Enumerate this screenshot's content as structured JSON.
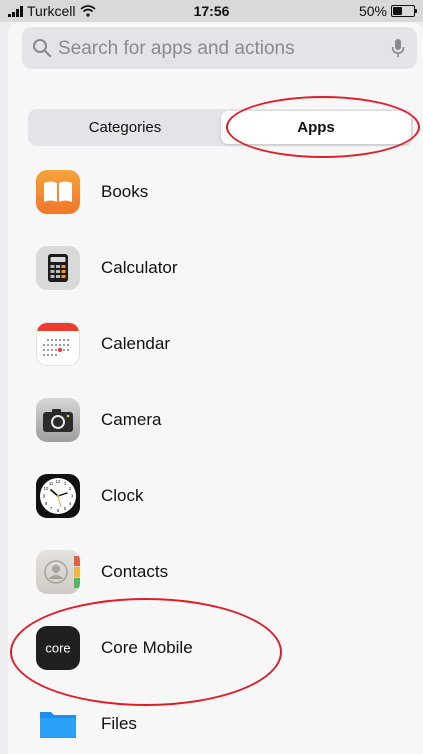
{
  "status_bar": {
    "carrier": "Turkcell",
    "time": "17:56",
    "battery_text": "50%",
    "battery_level": 0.5
  },
  "search": {
    "placeholder": "Search for apps and actions",
    "value": "",
    "icon": "magnifying-glass-icon",
    "mic_icon": "microphone-icon"
  },
  "segmented_control": {
    "options": [
      {
        "label": "Categories",
        "selected": false
      },
      {
        "label": "Apps",
        "selected": true
      }
    ]
  },
  "apps": [
    {
      "name": "Books",
      "icon": "books-icon"
    },
    {
      "name": "Calculator",
      "icon": "calculator-icon"
    },
    {
      "name": "Calendar",
      "icon": "calendar-icon"
    },
    {
      "name": "Camera",
      "icon": "camera-icon"
    },
    {
      "name": "Clock",
      "icon": "clock-icon"
    },
    {
      "name": "Contacts",
      "icon": "contacts-icon"
    },
    {
      "name": "Core Mobile",
      "icon": "core-icon",
      "icon_text": "core"
    },
    {
      "name": "Files",
      "icon": "folder-icon"
    }
  ],
  "colors": {
    "annotation": "#e01e2a",
    "books": "#f28a2e",
    "files": "#1d8ff2"
  }
}
